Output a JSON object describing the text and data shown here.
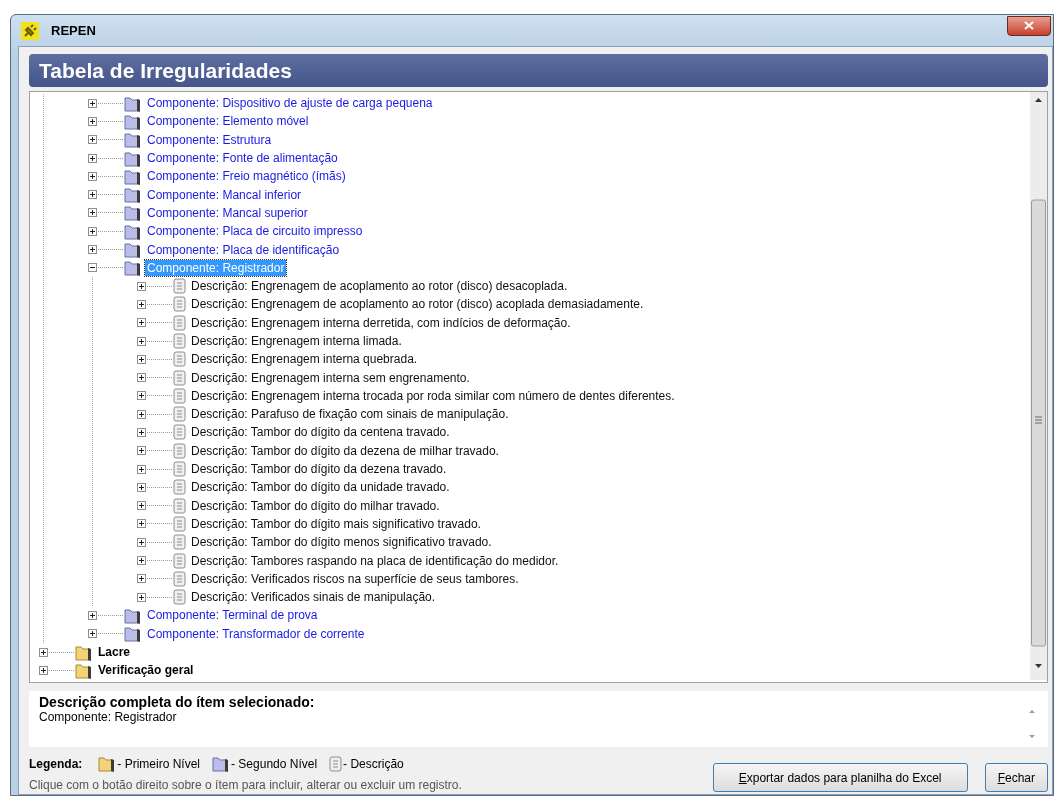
{
  "window": {
    "title": "REPEN"
  },
  "header": {
    "title": "Tabela de Irregularidades"
  },
  "tree": {
    "continued_children": [
      {
        "kind": "second_level",
        "label": "Componente: Dispositivo de ajuste de carga pequena",
        "expanded": false,
        "selected": false
      },
      {
        "kind": "second_level",
        "label": "Componente: Elemento móvel",
        "expanded": false,
        "selected": false
      },
      {
        "kind": "second_level",
        "label": "Componente: Estrutura",
        "expanded": false,
        "selected": false
      },
      {
        "kind": "second_level",
        "label": "Componente: Fonte de alimentação",
        "expanded": false,
        "selected": false
      },
      {
        "kind": "second_level",
        "label": "Componente: Freio magnético (ímãs)",
        "expanded": false,
        "selected": false
      },
      {
        "kind": "second_level",
        "label": "Componente: Mancal inferior",
        "expanded": false,
        "selected": false
      },
      {
        "kind": "second_level",
        "label": "Componente: Mancal superior",
        "expanded": false,
        "selected": false
      },
      {
        "kind": "second_level",
        "label": "Componente: Placa de circuito impresso",
        "expanded": false,
        "selected": false
      },
      {
        "kind": "second_level",
        "label": "Componente: Placa de identificação",
        "expanded": false,
        "selected": false
      },
      {
        "kind": "second_level",
        "label": "Componente: Registrador",
        "expanded": true,
        "selected": true,
        "children": [
          {
            "kind": "description",
            "label": "Descrição: Engrenagem de acoplamento ao rotor (disco) desacoplada.",
            "expanded": false,
            "selected": false
          },
          {
            "kind": "description",
            "label": "Descrição: Engrenagem de acoplamento ao rotor (disco) acoplada demasiadamente.",
            "expanded": false,
            "selected": false
          },
          {
            "kind": "description",
            "label": "Descrição: Engrenagem interna derretida, com indícios de deformação.",
            "expanded": false,
            "selected": false
          },
          {
            "kind": "description",
            "label": "Descrição: Engrenagem interna limada.",
            "expanded": false,
            "selected": false
          },
          {
            "kind": "description",
            "label": "Descrição: Engrenagem interna quebrada.",
            "expanded": false,
            "selected": false
          },
          {
            "kind": "description",
            "label": "Descrição: Engrenagem interna sem engrenamento.",
            "expanded": false,
            "selected": false
          },
          {
            "kind": "description",
            "label": "Descrição: Engrenagem interna trocada por roda similar com número de dentes diferentes.",
            "expanded": false,
            "selected": false
          },
          {
            "kind": "description",
            "label": "Descrição: Parafuso de fixação com sinais de manipulação.",
            "expanded": false,
            "selected": false
          },
          {
            "kind": "description",
            "label": "Descrição: Tambor do dígito da centena travado.",
            "expanded": false,
            "selected": false
          },
          {
            "kind": "description",
            "label": "Descrição: Tambor do dígito da dezena de milhar travado.",
            "expanded": false,
            "selected": false
          },
          {
            "kind": "description",
            "label": "Descrição: Tambor do dígito da dezena travado.",
            "expanded": false,
            "selected": false
          },
          {
            "kind": "description",
            "label": "Descrição: Tambor do dígito da unidade travado.",
            "expanded": false,
            "selected": false
          },
          {
            "kind": "description",
            "label": "Descrição: Tambor do dígito do milhar travado.",
            "expanded": false,
            "selected": false
          },
          {
            "kind": "description",
            "label": "Descrição: Tambor do dígito mais significativo travado.",
            "expanded": false,
            "selected": false
          },
          {
            "kind": "description",
            "label": "Descrição: Tambor do dígito menos significativo travado.",
            "expanded": false,
            "selected": false
          },
          {
            "kind": "description",
            "label": "Descrição: Tambores raspando na placa de identificação do medidor.",
            "expanded": false,
            "selected": false
          },
          {
            "kind": "description",
            "label": "Descrição: Verificados riscos na superfície de seus tambores.",
            "expanded": false,
            "selected": false
          },
          {
            "kind": "description",
            "label": "Descrição: Verificados sinais de manipulação.",
            "expanded": false,
            "selected": false
          }
        ]
      },
      {
        "kind": "second_level",
        "label": "Componente: Terminal de prova",
        "expanded": false,
        "selected": false
      },
      {
        "kind": "second_level",
        "label": "Componente: Transformador de corrente",
        "expanded": false,
        "selected": false
      }
    ],
    "roots": [
      {
        "kind": "first_level",
        "label": "Lacre",
        "expanded": false,
        "selected": false
      },
      {
        "kind": "first_level",
        "label": "Verificação geral",
        "expanded": false,
        "selected": false
      }
    ]
  },
  "detail": {
    "heading": "Descrição completa do ítem selecionado:",
    "value": "Componente: Registrador"
  },
  "legend": {
    "title": "Legenda:",
    "items": [
      {
        "kind": "first_level",
        "label": "- Primeiro Nível"
      },
      {
        "kind": "second_level",
        "label": "- Segundo Nível"
      },
      {
        "kind": "description",
        "label": "- Descrição"
      }
    ]
  },
  "hint": "Clique com o botão direito sobre o ítem para incluir, alterar ou excluir um registro.",
  "buttons": [
    {
      "label": "Exportar dados para planilha do Excel"
    },
    {
      "label": "Fechar"
    }
  ]
}
